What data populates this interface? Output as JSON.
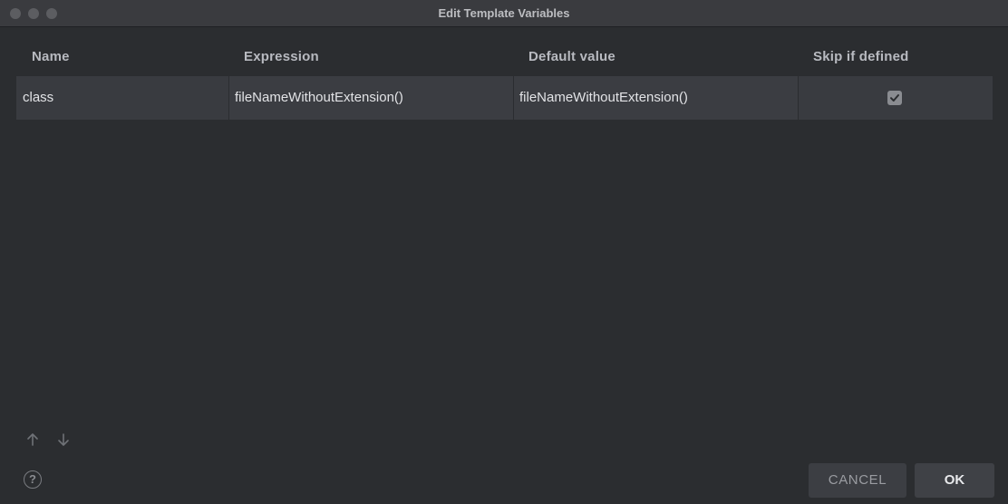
{
  "window": {
    "title": "Edit Template Variables"
  },
  "table": {
    "columns": [
      "Name",
      "Expression",
      "Default value",
      "Skip if defined"
    ],
    "rows": [
      {
        "name": "class",
        "expression": "fileNameWithoutExtension()",
        "default_value": "fileNameWithoutExtension()",
        "skip_if_defined": true
      }
    ]
  },
  "controls": {
    "move_up_icon": "arrow-up-icon",
    "move_down_icon": "arrow-down-icon",
    "help_label": "?"
  },
  "buttons": {
    "cancel": "CANCEL",
    "ok": "OK"
  },
  "colors": {
    "background": "#2b2d30",
    "row": "#393b40",
    "text": "#e2e3e6"
  }
}
